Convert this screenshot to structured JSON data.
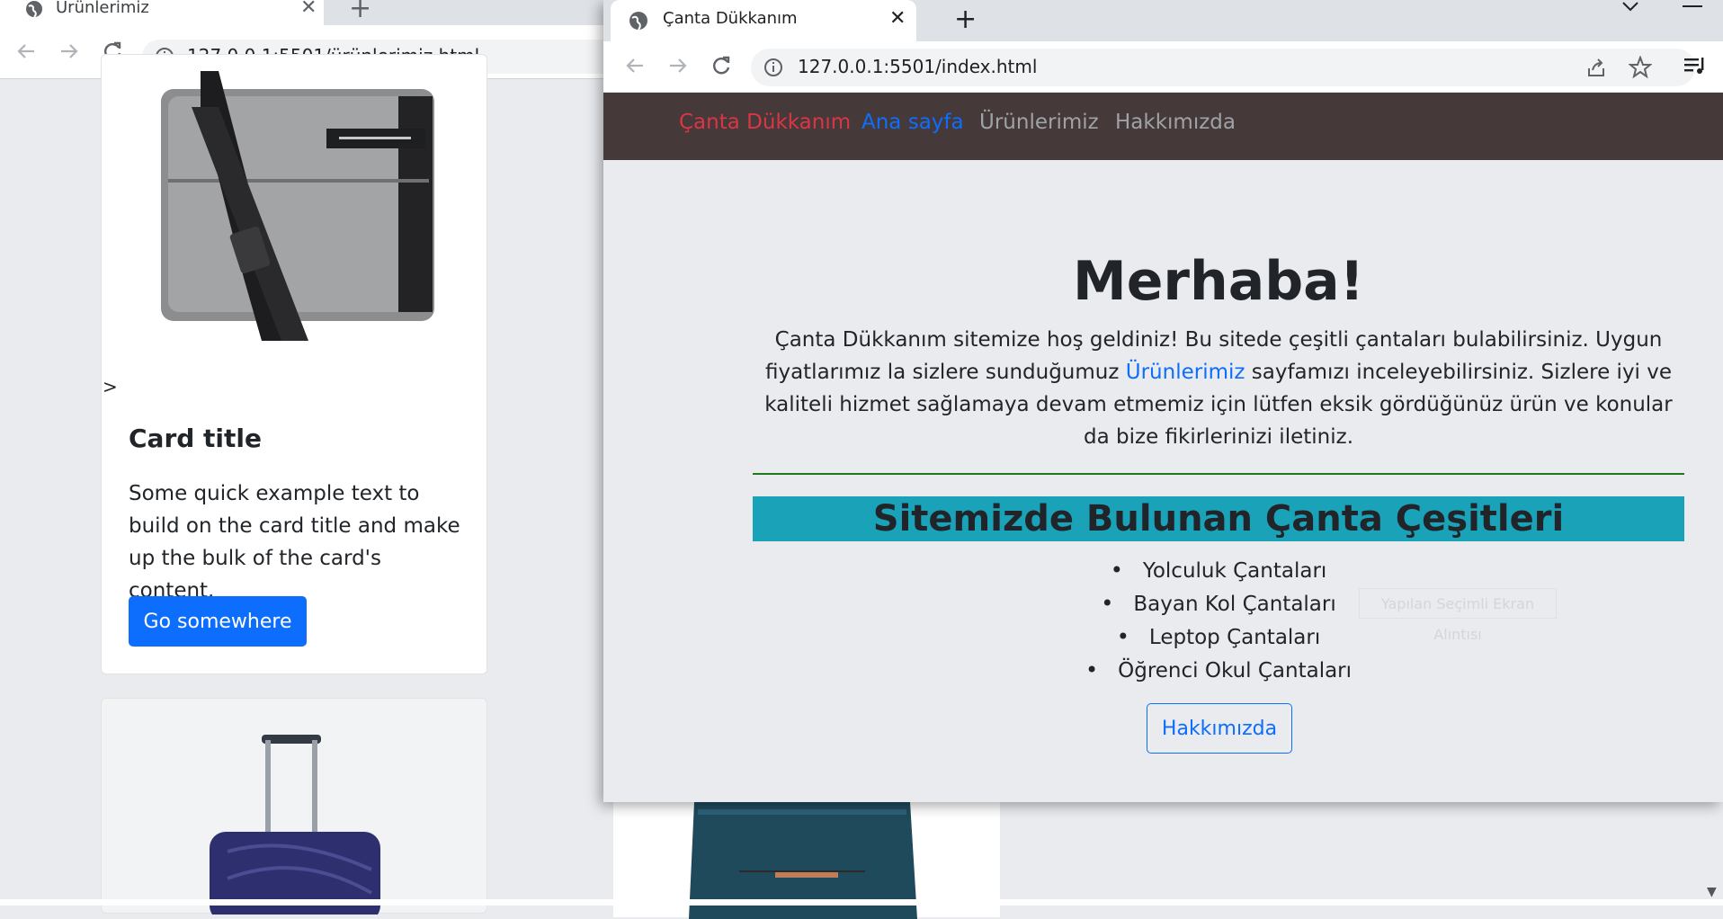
{
  "back_window": {
    "tab": {
      "title": "Ürünlerimiz",
      "close": "✕"
    },
    "new_tab": "+",
    "address_bar": {
      "url": "127.0.0.1:5501/ürünlerimiz.html"
    },
    "stray_char": ">",
    "card": {
      "title": "Card title",
      "text": "Some quick example text to build on the card title and make up the bulk of the card's content.",
      "button_label": "Go somewhere"
    }
  },
  "front_window": {
    "tab": {
      "title": "Çanta Dükkanım",
      "close": "✕"
    },
    "new_tab": "+",
    "address_bar": {
      "url": "127.0.0.1:5501/index.html"
    },
    "navbar": {
      "brand": "Çanta Dükkanım",
      "links": [
        "Ana sayfa",
        "Ürünlerimiz",
        "Hakkımızda"
      ]
    },
    "hero": {
      "title": "Merhaba!",
      "text_before_link": "Çanta Dükkanım sitemize hoş geldiniz! Bu sitede çeşitli çantaları bulabilirsiniz. Uygun fiyatlarımız la sizlere sunduğumuz ",
      "link_text": "Ürünlerimiz",
      "text_after_link": " sayfamızı inceleyebilirsiniz. Sizlere iyi ve kaliteli hizmet sağlamaya devam etmemiz için lütfen eksik gördüğünüz ürün ve konular da bize fikirlerinizi iletiniz."
    },
    "section_title": "Sitemizde Bulunan Çanta Çeşitleri",
    "bag_types": [
      "Yolculuk Çantaları",
      "Bayan Kol Çantaları",
      "Leptop Çantaları",
      "Öğrenci Okul Çantaları"
    ],
    "about_button": "Hakkımızda",
    "ghost_overlay_text": "Yapılan Seçimli Ekran Alıntısı"
  }
}
